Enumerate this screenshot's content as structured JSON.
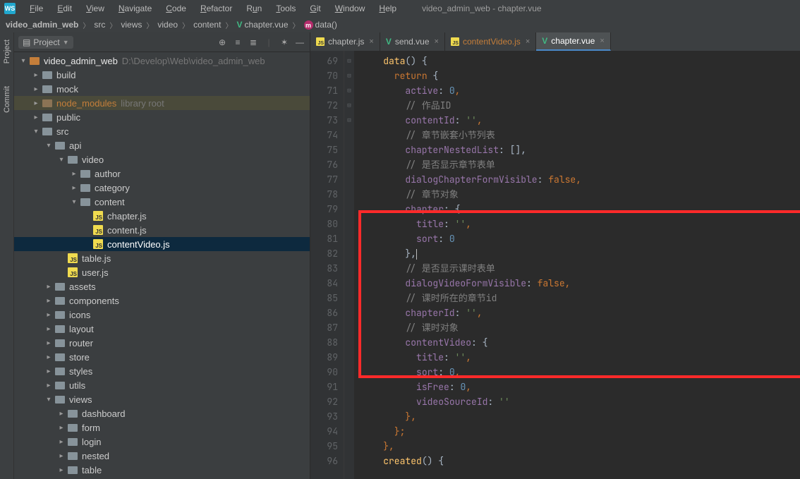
{
  "window": {
    "title": "video_admin_web - chapter.vue"
  },
  "menu": {
    "file": "File",
    "edit": "Edit",
    "view": "View",
    "navigate": "Navigate",
    "code": "Code",
    "refactor": "Refactor",
    "run": "Run",
    "tools": "Tools",
    "git": "Git",
    "window": "Window",
    "help": "Help"
  },
  "breadcrumbs": {
    "items": [
      "video_admin_web",
      "src",
      "views",
      "video",
      "content",
      "chapter.vue",
      "data()"
    ]
  },
  "left_tabs": {
    "project": "Project",
    "commit": "Commit"
  },
  "sidebar": {
    "title": "Project",
    "root": {
      "name": "video_admin_web",
      "path": "D:\\Develop\\Web\\video_admin_web"
    },
    "nodes": {
      "build": "build",
      "mock": "mock",
      "node_modules": "node_modules",
      "node_modules_sub": "library root",
      "public": "public",
      "src": "src",
      "api": "api",
      "video": "video",
      "author": "author",
      "category": "category",
      "content": "content",
      "chapter_js": "chapter.js",
      "content_js": "content.js",
      "contentVideo_js": "contentVideo.js",
      "table_js": "table.js",
      "user_js": "user.js",
      "assets": "assets",
      "components": "components",
      "icons": "icons",
      "layout": "layout",
      "router": "router",
      "store": "store",
      "styles": "styles",
      "utils": "utils",
      "views": "views",
      "dashboard": "dashboard",
      "form": "form",
      "login": "login",
      "nested": "nested",
      "table": "table"
    }
  },
  "tabs": {
    "chapter_js": "chapter.js",
    "send_vue": "send.vue",
    "contentVideo_js": "contentVideo.js",
    "chapter_vue": "chapter.vue"
  },
  "lines": {
    "start": 69,
    "end": 96
  },
  "chart_data": {
    "type": "table",
    "title": "Vue data() return object",
    "data": {
      "active": 0,
      "contentId": "",
      "chapterNestedList": [],
      "dialogChapterFormVisible": false,
      "chapter": {
        "title": "",
        "sort": 0
      },
      "dialogVideoFormVisible": false,
      "chapterId": "",
      "contentVideo": {
        "title": "",
        "sort": 0,
        "isFree": 0,
        "videoSourceId": ""
      }
    },
    "comments": {
      "contentId": "作品ID",
      "chapterNestedList": "章节嵌套小节列表",
      "dialogChapterFormVisible": "是否显示章节表单",
      "chapter": "章节对象",
      "dialogVideoFormVisible": "是否显示课时表单",
      "chapterId": "课时所在的章节id",
      "contentVideo": "课时对象"
    }
  },
  "code": {
    "l69_a": "data",
    "l69_b": "() {",
    "l70_a": "return ",
    "l70_b": "{",
    "l71_a": "active",
    "l71_b": ": ",
    "l71_c": "0",
    "l71_d": ",",
    "l72": "// 作品ID",
    "l73_a": "contentId",
    "l73_b": ": ",
    "l73_c": "''",
    "l73_d": ",",
    "l74": "// 章节嵌套小节列表",
    "l75_a": "chapterNestedList",
    "l75_b": ": [],",
    "l76": "// 是否显示章节表单",
    "l77_a": "dialogChapterFormVisible",
    "l77_b": ": ",
    "l77_c": "false",
    "l77_d": ",",
    "l78": "// 章节对象",
    "l79_a": "chapter",
    "l79_b": ": {",
    "l80_a": "title",
    "l80_b": ": ",
    "l80_c": "''",
    "l80_d": ",",
    "l81_a": "sort",
    "l81_b": ": ",
    "l81_c": "0",
    "l82": "},",
    "l83": "// 是否显示课时表单",
    "l84_a": "dialogVideoFormVisible",
    "l84_b": ": ",
    "l84_c": "false",
    "l84_d": ",",
    "l85": "// 课时所在的章节id",
    "l86_a": "chapterId",
    "l86_b": ": ",
    "l86_c": "''",
    "l86_d": ",",
    "l87": "// 课时对象",
    "l88_a": "contentVideo",
    "l88_b": ": {",
    "l89_a": "title",
    "l89_b": ": ",
    "l89_c": "''",
    "l89_d": ",",
    "l90_a": "sort",
    "l90_b": ": ",
    "l90_c": "0",
    "l90_d": ",",
    "l91_a": "isFree",
    "l91_b": ": ",
    "l91_c": "0",
    "l91_d": ",",
    "l92_a": "videoSourceId",
    "l92_b": ": ",
    "l92_c": "''",
    "l93": "},",
    "l94": "};",
    "l95": "},",
    "l96_a": "created",
    "l96_b": "() {"
  }
}
